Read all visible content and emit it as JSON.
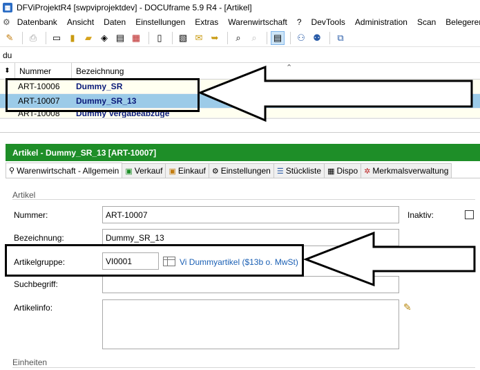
{
  "window": {
    "title": "DFViProjektR4 [swpviprojektdev] - DOCUframe 5.9 R4 - [Artikel]"
  },
  "menu": {
    "items": [
      "Datenbank",
      "Ansicht",
      "Daten",
      "Einstellungen",
      "Extras",
      "Warenwirtschaft",
      "?",
      "DevTools",
      "Administration",
      "Scan",
      "Belegerer"
    ]
  },
  "filter": {
    "value": "du"
  },
  "grid": {
    "columns": {
      "nummer": "Nummer",
      "bezeichnung": "Bezeichnung"
    },
    "rows": [
      {
        "nummer": "ART-10006",
        "bezeichnung": "Dummy_SR"
      },
      {
        "nummer": "ART-10007",
        "bezeichnung": "Dummy_SR_13"
      },
      {
        "nummer": "ART-10008",
        "bezeichnung": "Dummy Vergabeabzüge"
      }
    ],
    "selected_index": 1
  },
  "detail": {
    "header": "Artikel  -  Dummy_SR_13 [ART-10007]",
    "tabs": [
      {
        "label": "Warenwirtschaft - Allgemein",
        "icon": "paperclip-icon"
      },
      {
        "label": "Verkauf",
        "icon": "sale-icon"
      },
      {
        "label": "Einkauf",
        "icon": "purchase-icon"
      },
      {
        "label": "Einstellungen",
        "icon": "gear-icon"
      },
      {
        "label": "Stückliste",
        "icon": "list-icon"
      },
      {
        "label": "Dispo",
        "icon": "calendar-icon"
      },
      {
        "label": "Merkmalsverwaltung",
        "icon": "features-icon"
      }
    ],
    "section_artikel": "Artikel",
    "section_einheiten": "Einheiten",
    "fields": {
      "nummer_label": "Nummer:",
      "nummer_value": "ART-10007",
      "inaktiv_label": "Inaktiv:",
      "bezeichnung_label": "Bezeichnung:",
      "bezeichnung_value": "Dummy_SR_13",
      "artikelgruppe_label": "Artikelgruppe:",
      "artikelgruppe_value": "VI0001",
      "artikelgruppe_link": "Vi Dummyartikel ($13b o. MwSt)",
      "suchbegriff_label": "Suchbegriff:",
      "suchbegriff_value": "",
      "artikelinfo_label": "Artikelinfo:",
      "artikelinfo_value": ""
    }
  },
  "colors": {
    "header_green": "#1e8e28",
    "selection_blue": "#9ccbe8",
    "link_blue": "#1a5fb4",
    "bold_text": "#0a1a7a"
  }
}
